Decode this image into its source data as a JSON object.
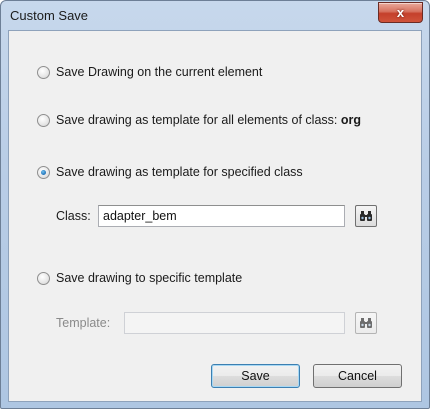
{
  "window": {
    "title": "Custom Save",
    "close_glyph": "x"
  },
  "options": [
    {
      "label": "Save Drawing on the current element",
      "checked": false
    },
    {
      "label": "Save drawing as template for all elements of class: ",
      "label_bold": "org",
      "checked": false
    },
    {
      "label": "Save drawing as template for specified class",
      "checked": true
    },
    {
      "label": "Save drawing to specific template",
      "checked": false
    }
  ],
  "class_field": {
    "label": "Class:",
    "value": "adapter_bem",
    "browse_icon": "binoculars-icon"
  },
  "template_field": {
    "label": "Template:",
    "value": "",
    "enabled": false,
    "browse_icon": "binoculars-icon"
  },
  "buttons": {
    "save": "Save",
    "cancel": "Cancel"
  }
}
